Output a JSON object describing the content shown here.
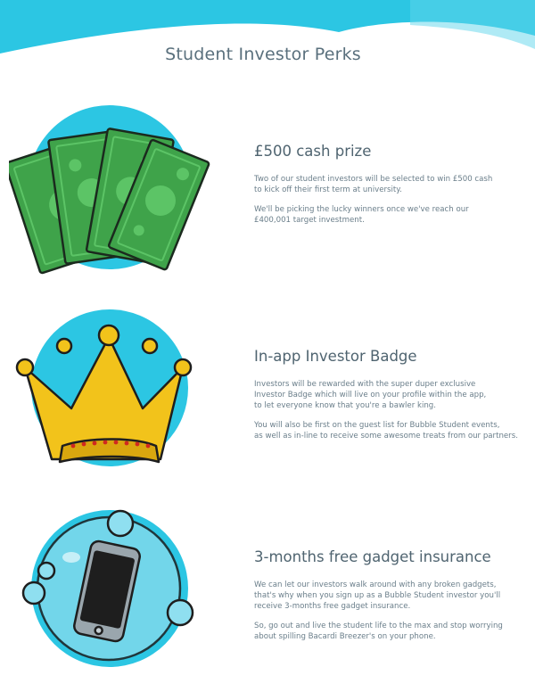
{
  "page": {
    "title": "Student Investor Perks"
  },
  "colors": {
    "accent": "#2cc6e3",
    "heading": "#4f6470",
    "body": "#6a7e8a",
    "cash": "#3fa34a",
    "crown": "#f2c31b"
  },
  "perks": [
    {
      "icon": "cash-bills-icon",
      "title": "£500 cash prize",
      "paragraphs": [
        "Two of our student investors will be selected to win £500 cash\nto kick off their first term at university.",
        "We'll be picking the lucky winners once we've reach our\n£400,001 target investment."
      ]
    },
    {
      "icon": "crown-icon",
      "title": "In-app Investor Badge",
      "paragraphs": [
        "Investors will be rewarded with the super duper exclusive\nInvestor Badge which will live on your profile within the app,\nto let everyone know that you're a bawler king.",
        "You will also be first on the guest list for Bubble Student events,\nas well as in-line to receive some awesome treats from our partners."
      ]
    },
    {
      "icon": "phone-bubble-icon",
      "title": "3-months free gadget insurance",
      "paragraphs": [
        "We can let our investors walk around with any broken gadgets,\nthat's why when you sign up as a Bubble Student investor you'll\nreceive 3-months free gadget insurance.",
        "So, go out and live the student life to the max and stop worrying\nabout spilling Bacardi Breezer's on your phone."
      ]
    }
  ]
}
